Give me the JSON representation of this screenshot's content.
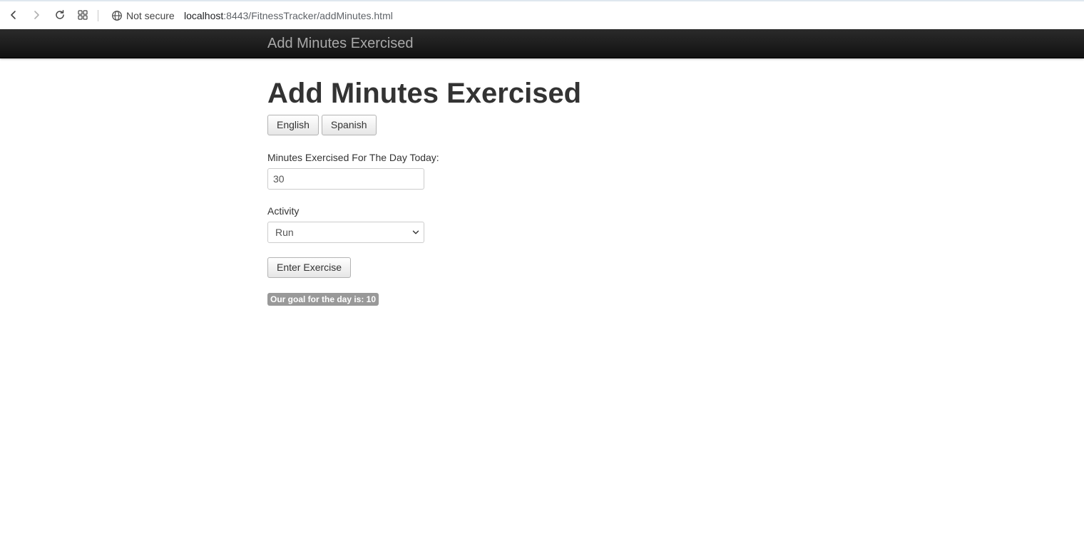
{
  "browser": {
    "security_label": "Not secure",
    "url_host": "localhost",
    "url_rest": ":8443/FitnessTracker/addMinutes.html"
  },
  "navbar": {
    "brand": "Add Minutes Exercised"
  },
  "page": {
    "title": "Add Minutes Exercised",
    "language_buttons": [
      "English",
      "Spanish"
    ],
    "minutes_label": "Minutes Exercised For The Day Today:",
    "minutes_value": "30",
    "activity_label": "Activity",
    "activity_selected": "Run",
    "submit_label": "Enter Exercise",
    "goal_text": "Our goal for the day is: 10"
  },
  "icons": {
    "back": "back-arrow-icon",
    "forward": "forward-arrow-icon",
    "reload": "reload-icon",
    "apps": "apps-grid-icon",
    "globe": "globe-icon",
    "dropdown": "chevron-down-icon"
  }
}
